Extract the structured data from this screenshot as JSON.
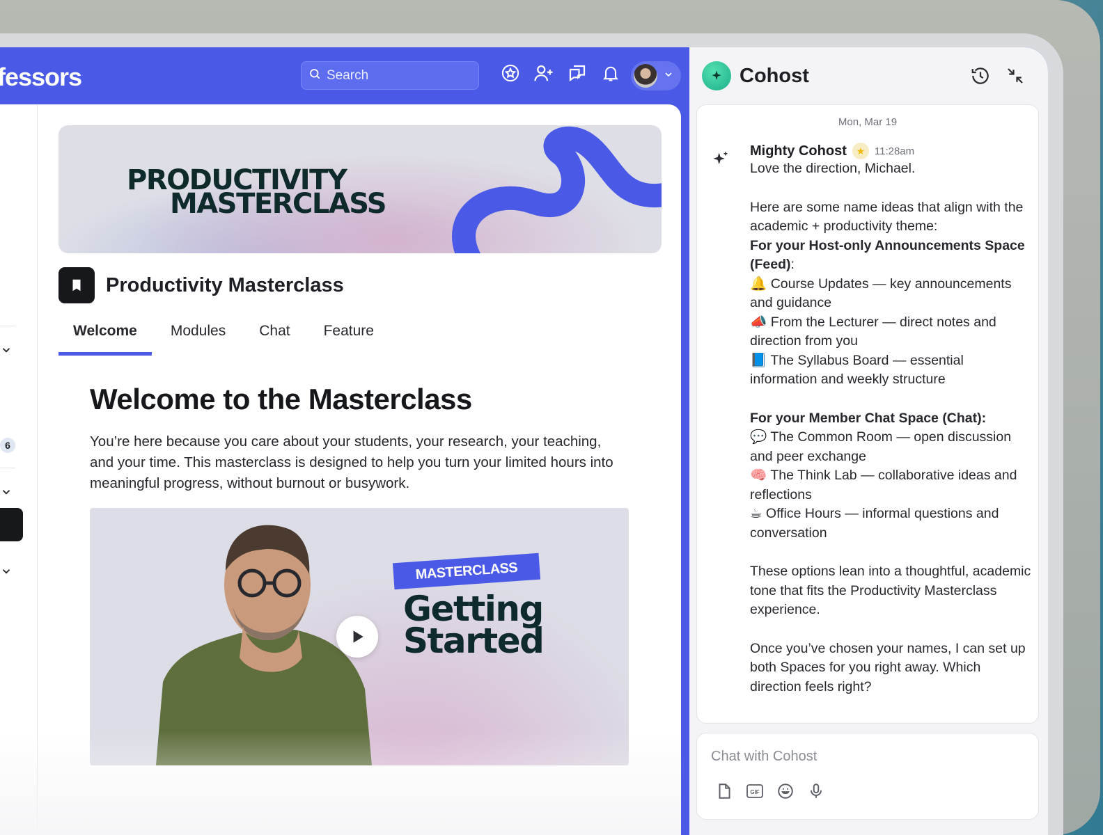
{
  "header": {
    "brand_fragment": "fessors",
    "search_placeholder": "Search"
  },
  "sidebar": {
    "badge_count": "6"
  },
  "banner": {
    "title_line1": "PRODUCTIVITY",
    "title_line2": "MASTERCLASS"
  },
  "space": {
    "name": "Productivity Masterclass",
    "tabs": [
      {
        "label": "Welcome",
        "active": true
      },
      {
        "label": "Modules",
        "active": false
      },
      {
        "label": "Chat",
        "active": false
      },
      {
        "label": "Feature",
        "active": false
      }
    ]
  },
  "welcome": {
    "heading": "Welcome to the Masterclass",
    "paragraph": "You’re here because you care about your students, your research, your teaching, and your time. This masterclass is designed to help you turn your limited hours into meaningful progress, without burnout or busywork."
  },
  "video": {
    "badge": "MASTERCLASS",
    "title_line1": "Getting",
    "title_line2": "Started"
  },
  "cohost": {
    "title": "Cohost",
    "date": "Mon, Mar 19",
    "sender": "Mighty Cohost",
    "time": "11:28am",
    "lines": {
      "l1": "Love the direction, Michael.",
      "l2": "Here are some name ideas that align with the academic + productivity theme:",
      "l3": "For your Host-only Announcements Space (Feed)",
      "l3_colon": ":",
      "l4": "🔔 Course Updates — key announcements and guidance",
      "l5": "📣 From the Lecturer — direct notes and direction from you",
      "l6": "📘 The Syllabus Board — essential information and weekly structure",
      "l7": "For your Member Chat Space (Chat):",
      "l8": "💬 The Common Room — open discussion and peer exchange",
      "l9": "🧠 The Think Lab — collaborative ideas and reflections",
      "l10": "☕ Office Hours — informal questions and conversation",
      "l11": "These options lean into a thoughtful, academic tone that fits the Productivity Masterclass experience.",
      "l12": "Once you’ve chosen your names, I can set up both Spaces for you right away. Which direction feels right?"
    },
    "input_placeholder": "Chat with Cohost",
    "tool_gif": "GIF"
  },
  "colors": {
    "accent": "#4a5ae6",
    "cohost_green": "#1cae89"
  }
}
